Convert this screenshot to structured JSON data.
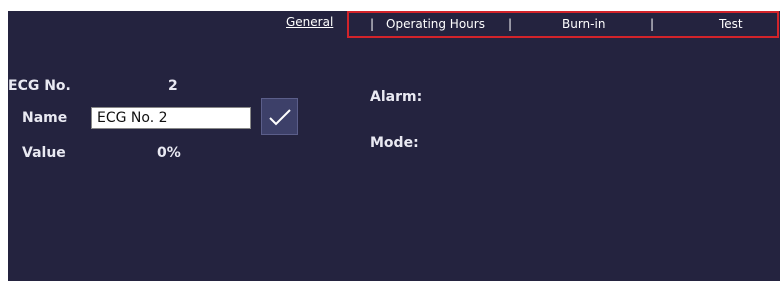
{
  "tabs": {
    "general": "General",
    "separator": "|",
    "operating_hours": "Operating Hours",
    "burn_in": "Burn-in",
    "test": "Test"
  },
  "left": {
    "ecg_no_label": "ECG No.",
    "ecg_no_value": "2",
    "name_label": "Name",
    "name_value": "ECG No. 2",
    "value_label": "Value",
    "value_value": "0%",
    "confirm_icon": "check-icon"
  },
  "right": {
    "alarm_label": "Alarm:",
    "mode_label": "Mode:"
  },
  "colors": {
    "panel_bg": "#24233f",
    "highlight_border": "#d2232a",
    "text": "#e9e9f2"
  }
}
